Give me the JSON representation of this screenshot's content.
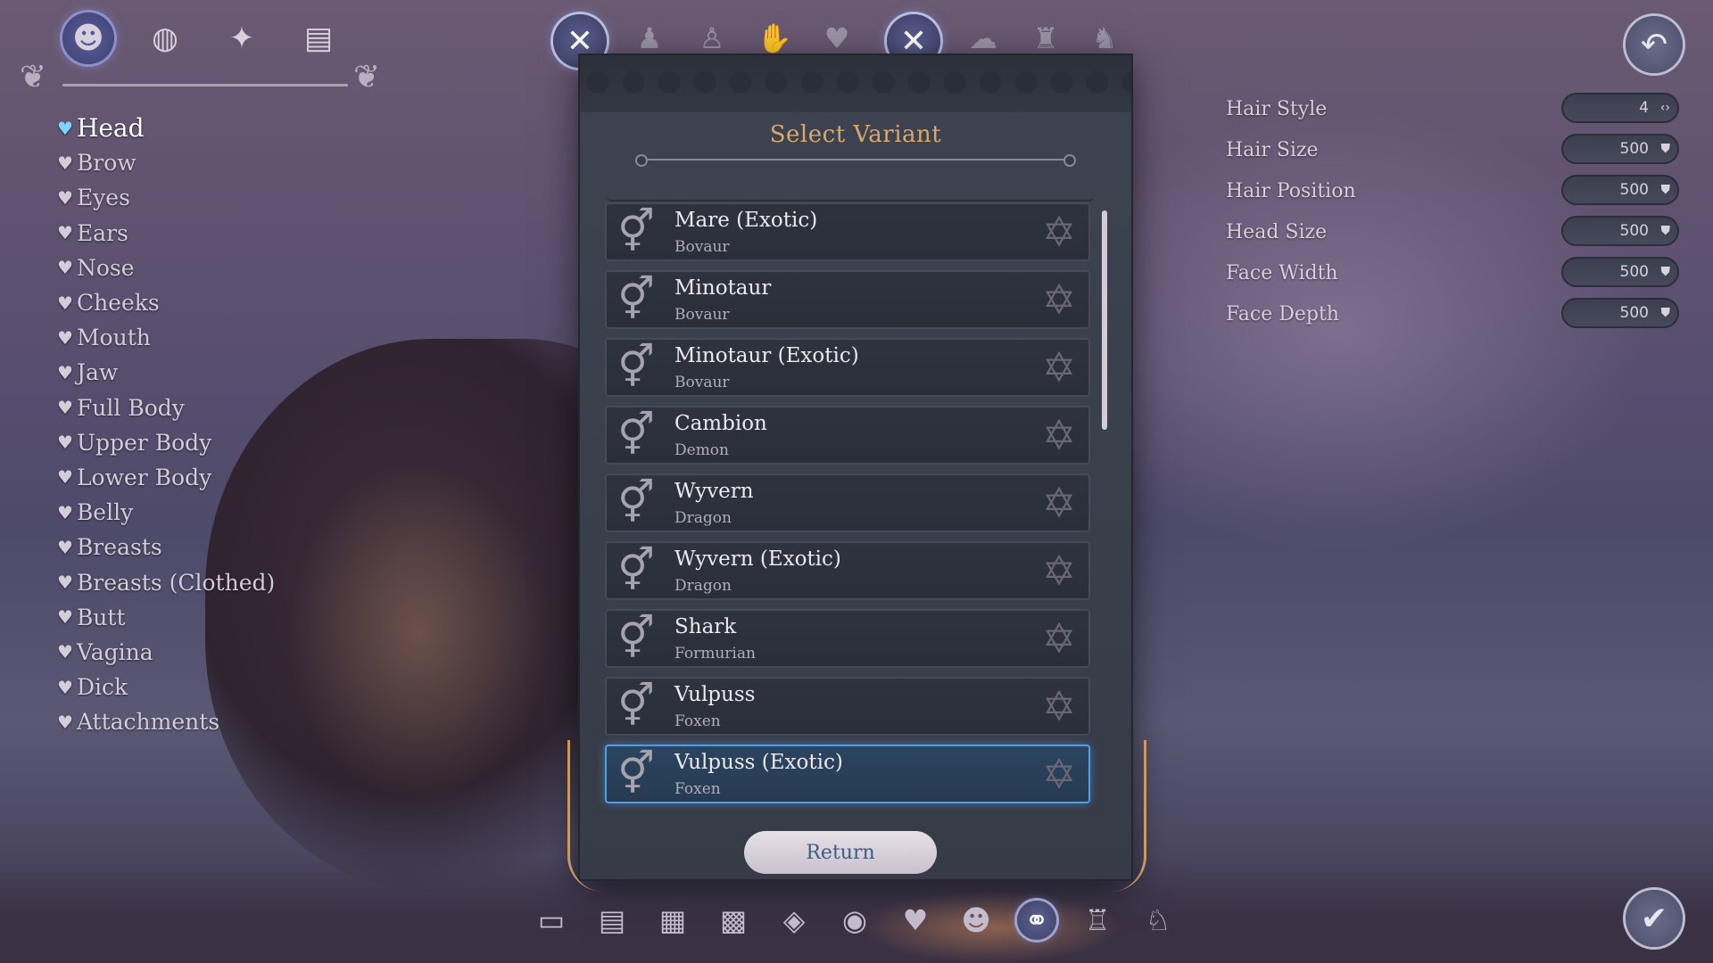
{
  "category_tabs": [
    {
      "icon": "head-mask-icon",
      "glyph": "☻",
      "active": true
    },
    {
      "icon": "globe-icon",
      "glyph": "◍",
      "active": false
    },
    {
      "icon": "sparkles-icon",
      "glyph": "✦",
      "active": false
    },
    {
      "icon": "notes-icon",
      "glyph": "▤",
      "active": false
    }
  ],
  "body_parts": [
    {
      "label": "Head",
      "active": true
    },
    {
      "label": "Brow"
    },
    {
      "label": "Eyes"
    },
    {
      "label": "Ears"
    },
    {
      "label": "Nose"
    },
    {
      "label": "Cheeks"
    },
    {
      "label": "Mouth"
    },
    {
      "label": "Jaw"
    },
    {
      "label": "Full Body"
    },
    {
      "label": "Upper Body"
    },
    {
      "label": "Lower Body"
    },
    {
      "label": "Belly"
    },
    {
      "label": "Breasts"
    },
    {
      "label": "Breasts (Clothed)"
    },
    {
      "label": "Butt"
    },
    {
      "label": "Vagina"
    },
    {
      "label": "Dick"
    },
    {
      "label": "Attachments"
    }
  ],
  "dialog": {
    "title": "Select Variant",
    "return_label": "Return",
    "variants": [
      {
        "name": "Mare (Exotic)",
        "race": "Bovaur",
        "selected": false
      },
      {
        "name": "Minotaur",
        "race": "Bovaur",
        "selected": false
      },
      {
        "name": "Minotaur (Exotic)",
        "race": "Bovaur",
        "selected": false
      },
      {
        "name": "Cambion",
        "race": "Demon",
        "selected": false
      },
      {
        "name": "Wyvern",
        "race": "Dragon",
        "selected": false
      },
      {
        "name": "Wyvern (Exotic)",
        "race": "Dragon",
        "selected": false
      },
      {
        "name": "Shark",
        "race": "Formurian",
        "selected": false
      },
      {
        "name": "Vulpuss",
        "race": "Foxen",
        "selected": false
      },
      {
        "name": "Vulpuss (Exotic)",
        "race": "Foxen",
        "selected": true
      }
    ]
  },
  "stats": [
    {
      "label": "Hair Style",
      "value": "4",
      "control": "arrows"
    },
    {
      "label": "Hair Size",
      "value": "500",
      "control": "shield"
    },
    {
      "label": "Hair Position",
      "value": "500",
      "control": "shield"
    },
    {
      "label": "Head Size",
      "value": "500",
      "control": "shield"
    },
    {
      "label": "Face Width",
      "value": "500",
      "control": "shield"
    },
    {
      "label": "Face Depth",
      "value": "500",
      "control": "shield"
    }
  ],
  "colors": {
    "accent": "#4f9fe8",
    "title_gold": "#d9a86a",
    "frame_gold": "#c69a62"
  }
}
